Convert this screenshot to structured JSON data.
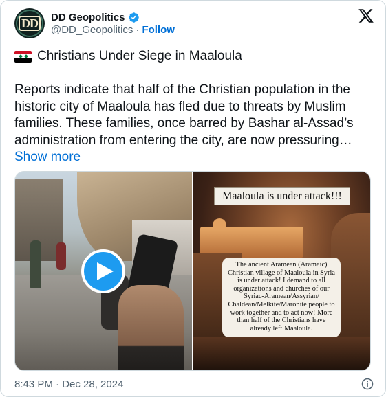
{
  "author": {
    "display_name": "DD Geopolitics",
    "handle": "@DD_Geopolitics",
    "separator": "·",
    "follow_label": "Follow",
    "avatar_text": "DD"
  },
  "post": {
    "title_flag": "syria-flag",
    "title": "Christians Under Siege in Maaloula",
    "body": "Reports indicate that half of the Christian population in the historic city of Maaloula has fled due to threats by Muslim families. These families, once barred by Bashar al-Assad’s administration from entering the city, are now pressuring…",
    "show_more": "Show more"
  },
  "media": {
    "left": {
      "type": "video-thumbnail",
      "play_icon": "play-icon"
    },
    "right": {
      "banner": "Maaloula is under attack!!!",
      "caption": "The ancient Aramean (Aramaic) Christian village of Maaloula in Syria is under attack! I demand to all organizations and churches of our Syriac-Aramean/Assyrian/ Chaldean/Melkite/Maronite people to work together and to act now! More than half of the Christians have already left Maaloula."
    }
  },
  "footer": {
    "timestamp": "8:43 PM · Dec 28, 2024",
    "info_icon": "info-icon"
  },
  "colors": {
    "link": "#006fd6",
    "secondary_text": "#536471",
    "verified": "#1d9bf0",
    "play_button": "#1d9bf0"
  }
}
